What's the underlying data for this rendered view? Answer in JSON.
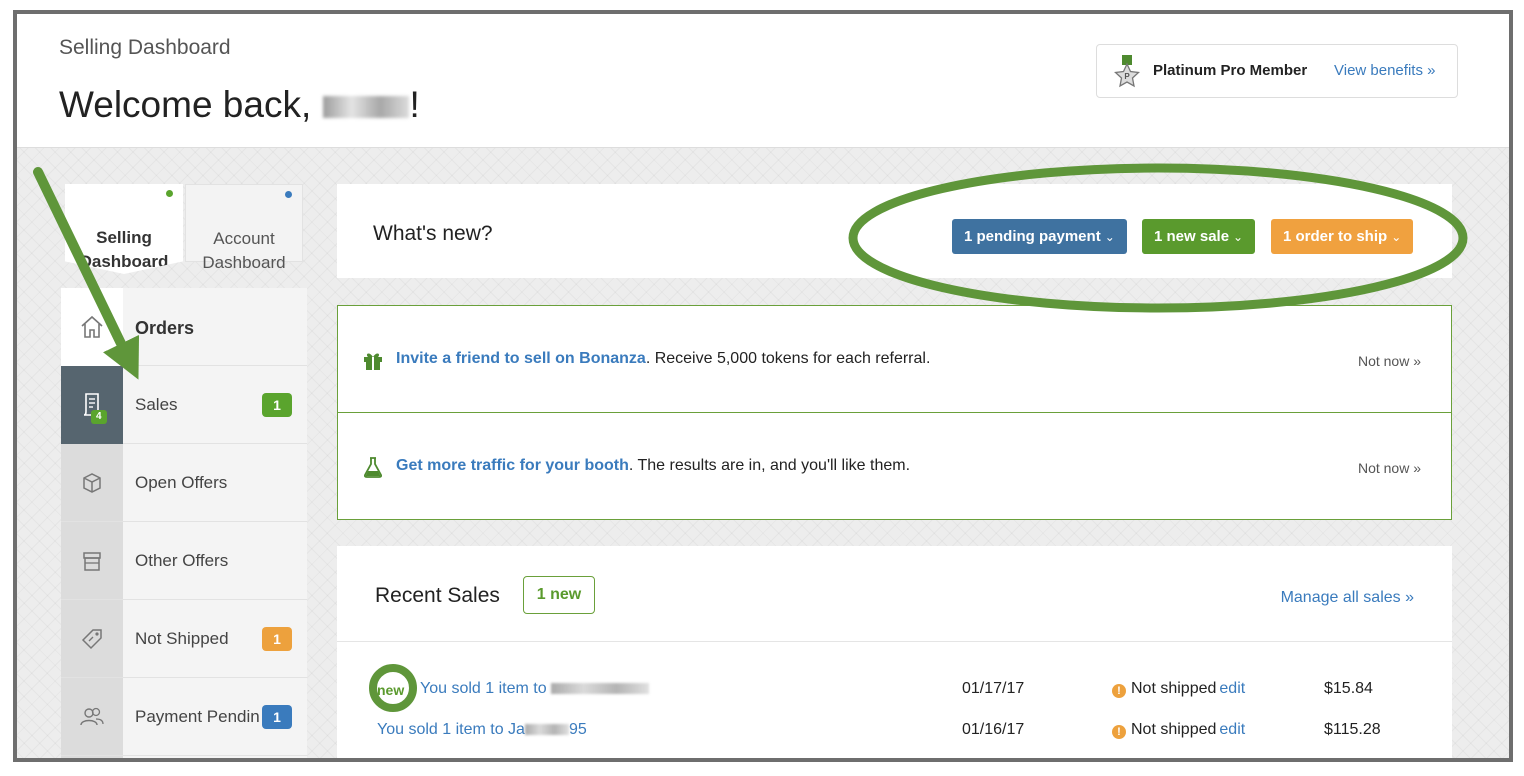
{
  "header": {
    "breadcrumb": "Selling Dashboard",
    "welcome_prefix": "Welcome back, ",
    "welcome_suffix": "!",
    "member_label": "Platinum Pro Member",
    "member_link": "View benefits »"
  },
  "tabs": [
    {
      "label": "Selling\nDashboard",
      "selected": true,
      "dot_color": "#5aa42d"
    },
    {
      "label": "Account\nDashboard",
      "selected": false,
      "dot_color": "#3a7bbd"
    }
  ],
  "sidenav": {
    "heading": "Orders",
    "items": [
      {
        "label": "Sales",
        "count": "1",
        "count_color": "#5aa42d",
        "icon": "receipt-icon",
        "icon_badge": "4",
        "active": true
      },
      {
        "label": "Open Offers",
        "icon": "box-icon"
      },
      {
        "label": "Other Offers",
        "icon": "storefront-icon"
      },
      {
        "label": "Not Shipped",
        "count": "1",
        "count_color": "#eda13d",
        "icon": "tag-icon"
      },
      {
        "label": "Payment Pendin",
        "count": "1",
        "count_color": "#3a7bbd",
        "icon": "users-icon"
      }
    ]
  },
  "whats_new": {
    "title": "What's new?",
    "pills": [
      {
        "label": "1 pending payment",
        "color": "#3f72a0"
      },
      {
        "label": "1 new sale",
        "color": "#5a9a2d"
      },
      {
        "label": "1 order to ship",
        "color": "#f0a13f"
      }
    ]
  },
  "promos": [
    {
      "link": "Invite a friend to sell on Bonanza",
      "text": ". Receive 5,000 tokens for each referral.",
      "dismiss": "Not now »",
      "icon": "gift-icon"
    },
    {
      "link": "Get more traffic for your booth",
      "text": ". The results are in, and you'll like them.",
      "dismiss": "Not now »",
      "icon": "flask-icon"
    }
  ],
  "recent_sales": {
    "title": "Recent Sales",
    "new_badge": "1 new",
    "manage_link": "Manage all sales »",
    "rows": [
      {
        "new_tag": "new",
        "sold_prefix": "You sold 1 item to ",
        "sold_suffix": "",
        "date": "01/17/17",
        "status": "Not shipped",
        "edit": "edit",
        "price": "$15.84"
      },
      {
        "new_tag": "",
        "sold_prefix": "You sold 1 item to Ja",
        "sold_suffix": "95",
        "date": "01/16/17",
        "status": "Not shipped",
        "edit": "edit",
        "price": "$115.28"
      }
    ]
  },
  "colors": {
    "accent_green": "#5a9a2d",
    "annotation_green": "#5f963a",
    "link_blue": "#3a7bbd"
  }
}
